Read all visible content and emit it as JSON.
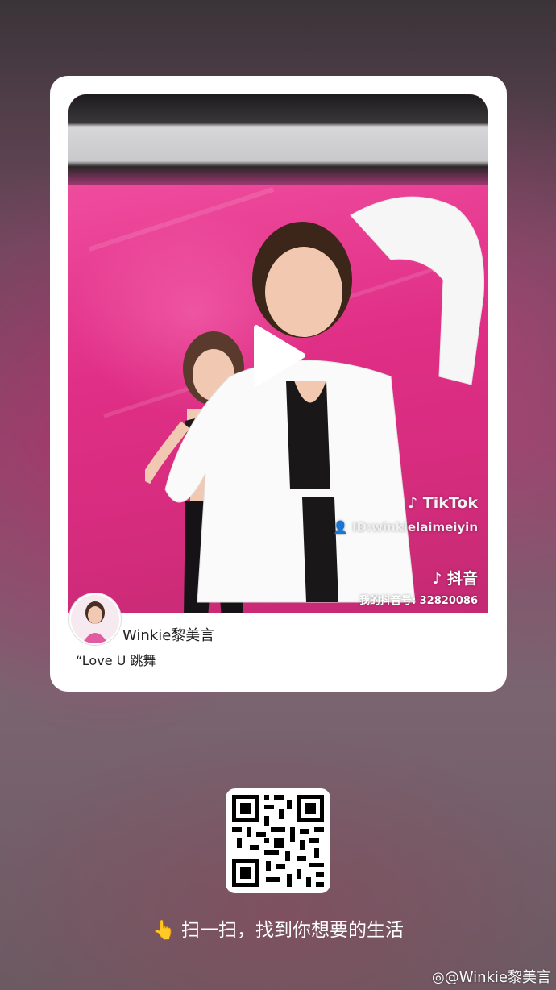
{
  "card": {
    "author_name": "Winkie黎美言",
    "caption": "“Love U 跳舞"
  },
  "video": {
    "tiktok_label": "TikTok",
    "tiktok_id": "ID:winkielaimeiyin",
    "douyin_label": "抖音",
    "douyin_number": "我的抖音号: 32820086"
  },
  "share": {
    "scan_prompt": "扫一扫，找到你想要的生活",
    "pointer_emoji": "👆"
  },
  "watermark": {
    "text": "@Winkie黎美言"
  },
  "colors": {
    "accent_pink": "#e23c8f",
    "card_bg": "#ffffff"
  }
}
